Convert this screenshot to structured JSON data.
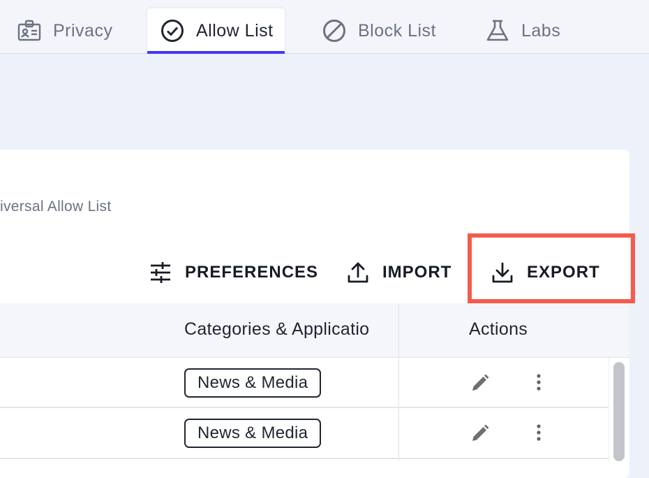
{
  "tabs": [
    {
      "label": "Privacy",
      "icon": "id-badge-icon",
      "active": false
    },
    {
      "label": "Allow List",
      "icon": "check-circle-icon",
      "active": true
    },
    {
      "label": "Block List",
      "icon": "block-icon",
      "active": false
    },
    {
      "label": "Labs",
      "icon": "flask-icon",
      "active": false
    }
  ],
  "card": {
    "subtitle": "iversal Allow List"
  },
  "toolbar": {
    "preferences_label": "PREFERENCES",
    "import_label": "IMPORT",
    "export_label": "EXPORT"
  },
  "table": {
    "columns": [
      "Categories & Applicatio",
      "Actions"
    ],
    "rows": [
      {
        "category": "News & Media"
      },
      {
        "category": "News & Media"
      }
    ]
  },
  "colors": {
    "accent": "#4338f0",
    "highlight": "#f45b4c",
    "background": "#edf1fa"
  }
}
